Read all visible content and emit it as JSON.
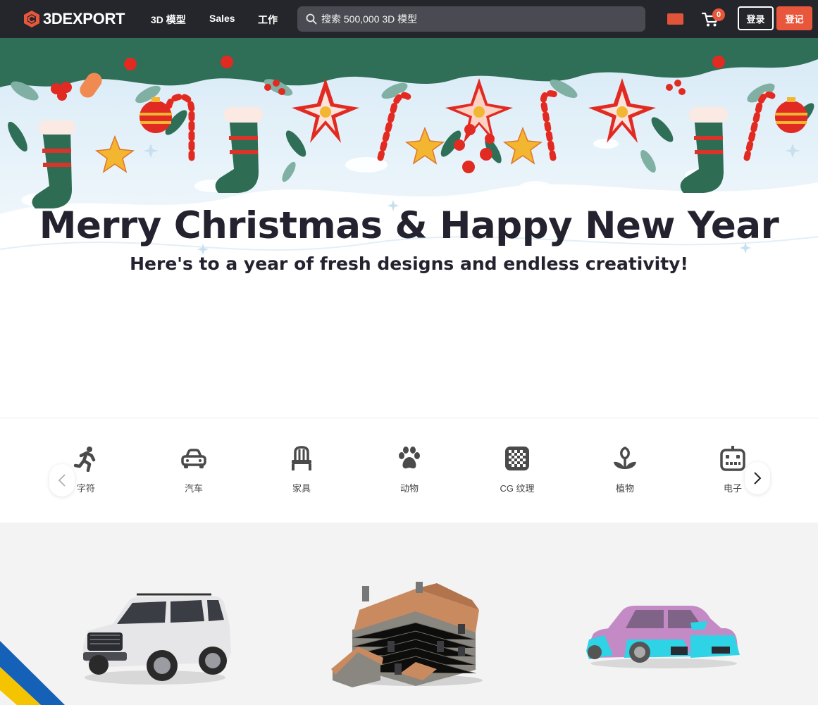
{
  "header": {
    "logo_text": "3DEXPORT",
    "nav": [
      "3D 模型",
      "Sales",
      "工作"
    ],
    "search_placeholder": "搜索 500,000 3D 模型",
    "cart_count": "0",
    "login_label": "登录",
    "signup_label": "登记",
    "flag_icon": "china-flag-icon"
  },
  "banner": {
    "title": "Merry Christmas & Happy New Year",
    "subtitle": "Here's to a year of fresh designs and endless creativity!"
  },
  "categories": [
    {
      "label": "字符",
      "icon": "running-person-icon"
    },
    {
      "label": "汽车",
      "icon": "car-icon"
    },
    {
      "label": "家具",
      "icon": "chair-icon"
    },
    {
      "label": "动物",
      "icon": "paw-icon"
    },
    {
      "label": "CG 纹理",
      "icon": "checker-texture-icon"
    },
    {
      "label": "植物",
      "icon": "plant-icon"
    },
    {
      "label": "电子",
      "icon": "robot-icon"
    }
  ],
  "products": [
    {
      "name": "suv-car-model"
    },
    {
      "name": "stone-house-model"
    },
    {
      "name": "sports-car-model"
    }
  ],
  "colors": {
    "header_bg": "#24262b",
    "accent": "#e8573c",
    "search_bg": "#4a4b52",
    "products_bg": "#f3f3f3"
  }
}
